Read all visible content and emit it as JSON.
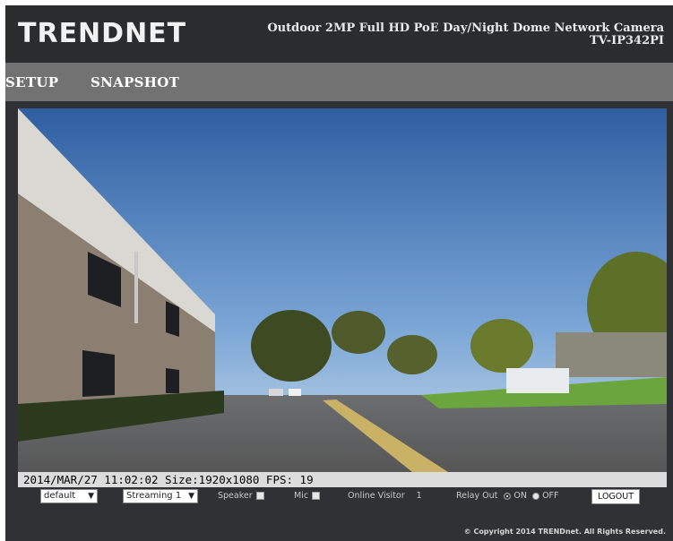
{
  "header": {
    "logo": "TRENDNET",
    "product_name": "Outdoor 2MP Full HD PoE Day/Night Dome Network Camera",
    "model": "TV-IP342PI"
  },
  "nav": {
    "items": [
      {
        "label": "SETUP"
      },
      {
        "label": "SNAPSHOT"
      }
    ]
  },
  "video": {
    "overlay_text": "2014/MAR/27 11:02:02 Size:1920x1080 FPS: 19"
  },
  "controls": {
    "profile_select": "default",
    "stream_select": "Streaming 1",
    "speaker_label": "Speaker",
    "mic_label": "Mic",
    "online_visitor_label": "Online Visitor",
    "online_visitor_count": "1",
    "relay_out_label": "Relay Out",
    "relay_on_label": "ON",
    "relay_off_label": "OFF",
    "relay_state": "ON",
    "logout_label": "LOGOUT"
  },
  "footer": {
    "copyright": "© Copyright 2014 TRENDnet. All Rights Reserved."
  },
  "colors": {
    "header_bg": "#2b2c2e",
    "nav_bg": "#727272",
    "content_bg": "#2f3134"
  }
}
